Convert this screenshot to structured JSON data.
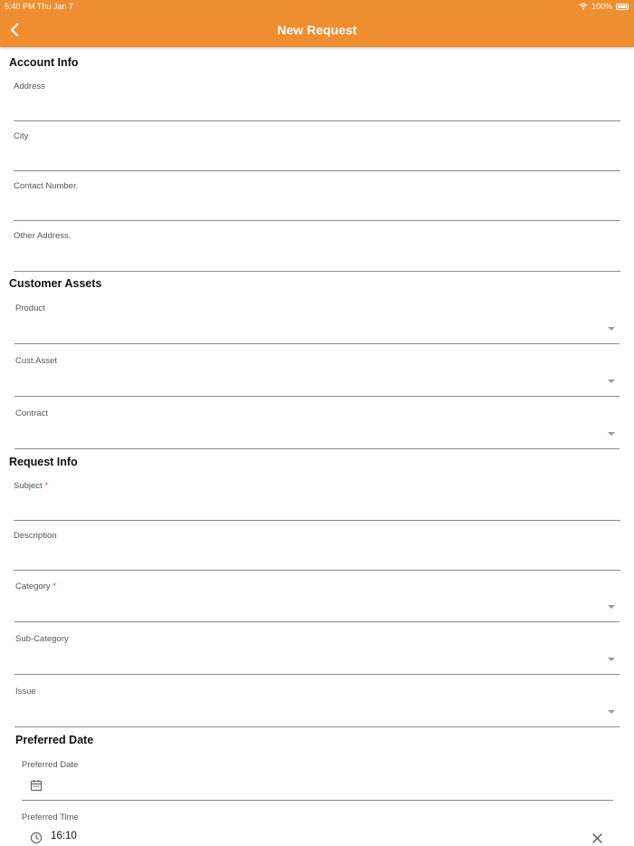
{
  "status_bar": {
    "time": "5:40 PM  Thu Jan 7",
    "battery": "100%"
  },
  "header": {
    "title": "New Request",
    "back_icon": "chevron-left-icon"
  },
  "sections": {
    "account_info": "Account Info",
    "customer_assets": "Customer Assets",
    "request_info": "Request Info",
    "preferred_date": "Preferred Date"
  },
  "fields": {
    "address": {
      "label": "Address",
      "value": ""
    },
    "city": {
      "label": "City",
      "value": ""
    },
    "contact_number": {
      "label": "Contact Number.",
      "value": ""
    },
    "other_address": {
      "label": "Other Address.",
      "value": ""
    },
    "product": {
      "label": "Product",
      "value": ""
    },
    "cust_asset": {
      "label": "Cust.Asset",
      "value": ""
    },
    "contract": {
      "label": "Contract",
      "value": ""
    },
    "subject": {
      "label": "Subject",
      "required": "*",
      "value": ""
    },
    "description": {
      "label": "Description",
      "value": ""
    },
    "category": {
      "label": "Category",
      "required": "*",
      "value": ""
    },
    "sub_category": {
      "label": "Sub-Category",
      "value": ""
    },
    "issue": {
      "label": "Issue",
      "value": ""
    },
    "preferred_date": {
      "label": "Preferred Date",
      "value": "",
      "icon": "calendar-icon"
    },
    "preferred_time": {
      "label": "Preferred Time",
      "value": "16:10",
      "icon": "clock-icon",
      "clear_icon": "close-icon"
    }
  },
  "colors": {
    "accent": "#ee8e31",
    "required": "#e53935"
  }
}
